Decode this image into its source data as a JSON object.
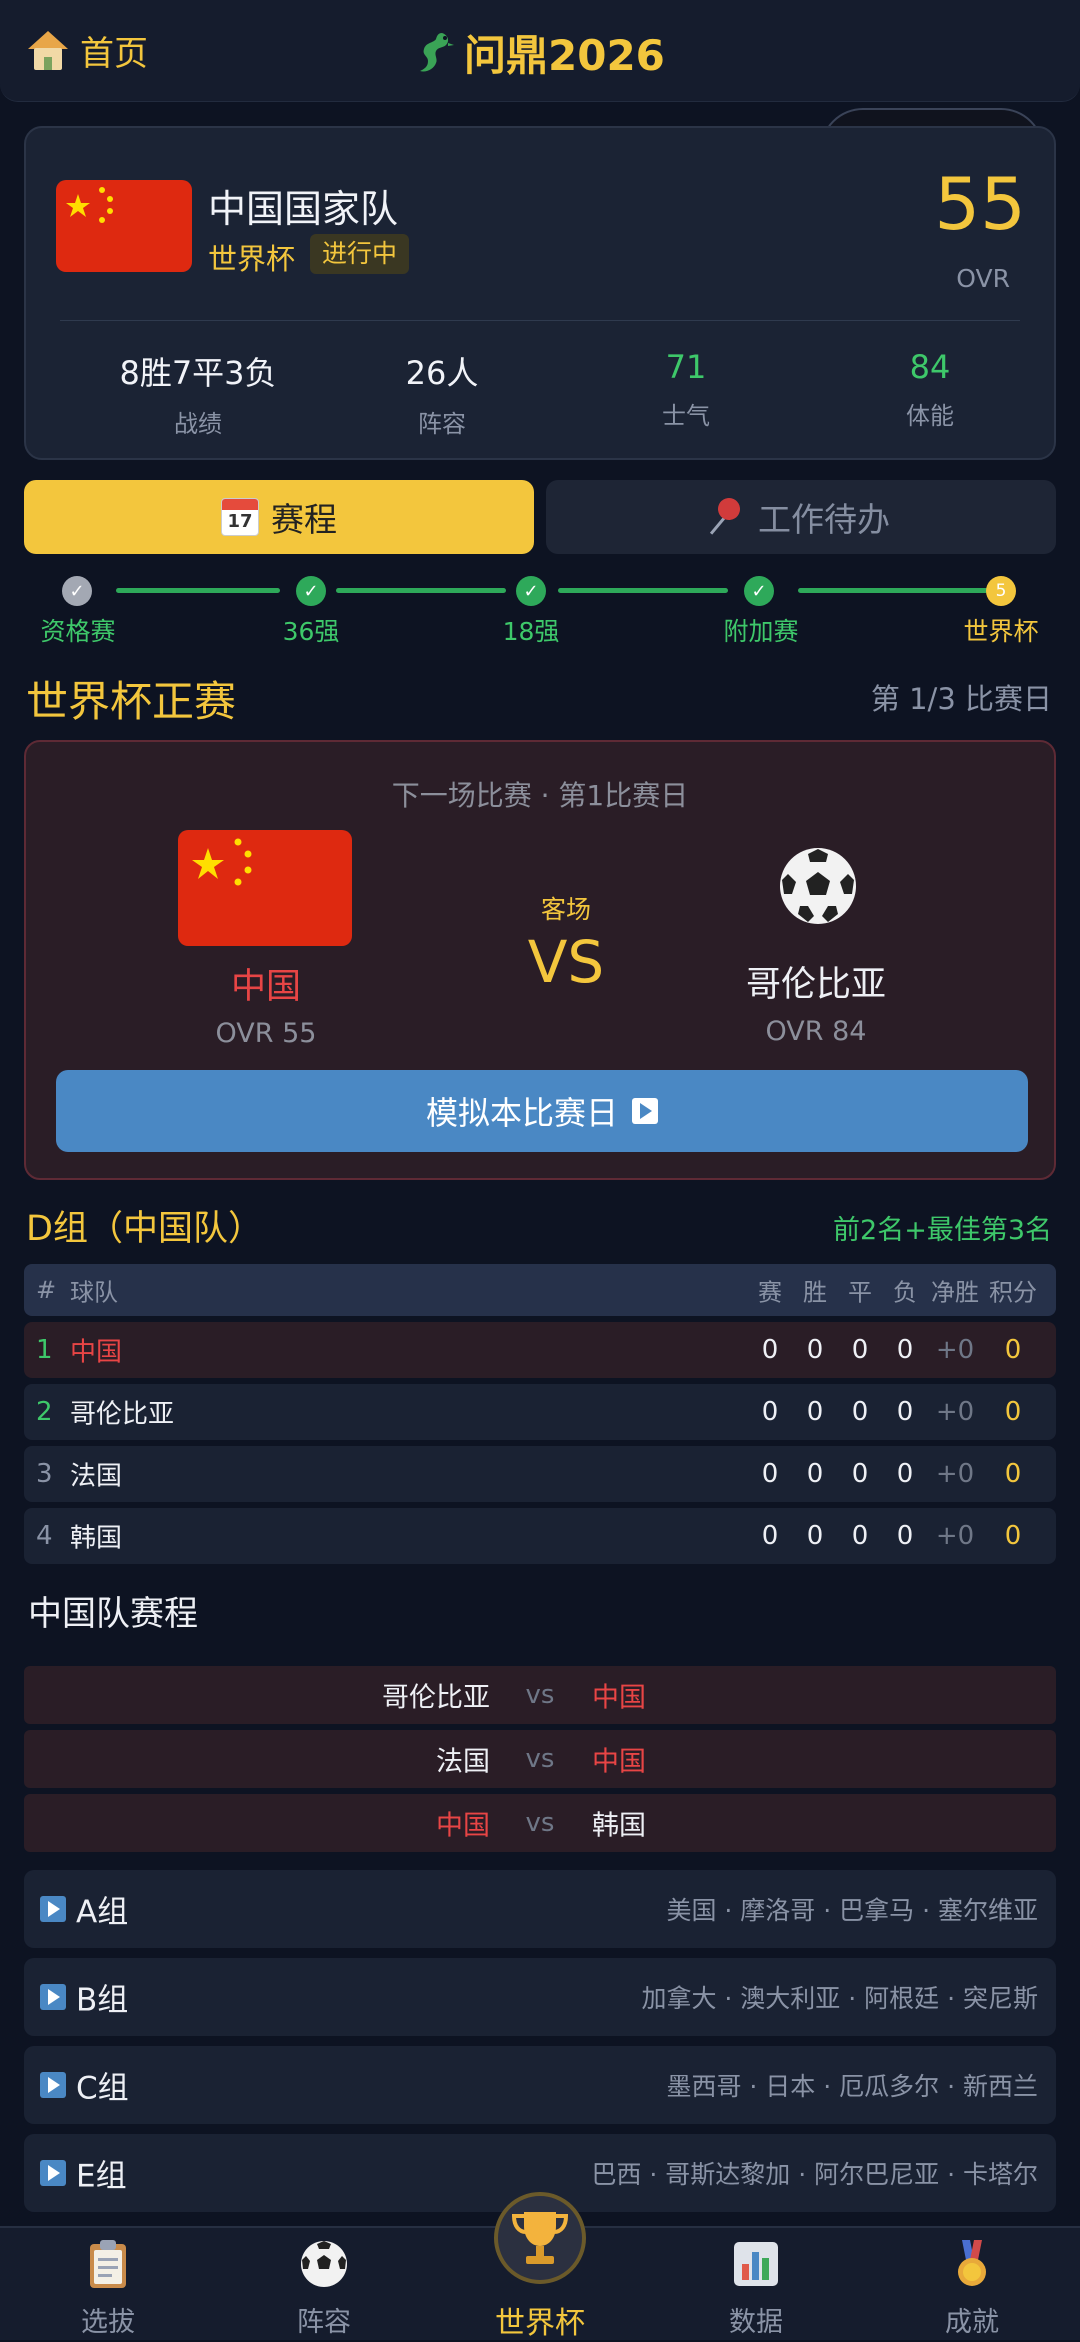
{
  "header": {
    "home_label": "首页",
    "brand": "问鼎2026"
  },
  "team_card": {
    "name": "中国国家队",
    "competition": "世界杯",
    "status": "进行中",
    "ovr": "55",
    "ovr_label": "OVR",
    "stats": [
      {
        "value": "8胜7平3负",
        "label": "战绩"
      },
      {
        "value": "26人",
        "label": "阵容"
      },
      {
        "value": "71",
        "label": "士气"
      },
      {
        "value": "84",
        "label": "体能"
      }
    ]
  },
  "tabs": {
    "schedule": "赛程",
    "todo": "工作待办",
    "calendar_day": "17"
  },
  "progress": {
    "stages": [
      {
        "label": "资格赛",
        "state": "done-grey"
      },
      {
        "label": "36强",
        "state": "done"
      },
      {
        "label": "18强",
        "state": "done"
      },
      {
        "label": "附加赛",
        "state": "done"
      },
      {
        "label": "世界杯",
        "state": "current",
        "num": "5"
      }
    ]
  },
  "section": {
    "title": "世界杯正赛",
    "matchday": "第 1/3 比赛日"
  },
  "next_match": {
    "subtitle": "下一场比赛 · 第1比赛日",
    "home_name": "中国",
    "home_ovr": "OVR 55",
    "venue": "客场",
    "vs": "VS",
    "away_name": "哥伦比亚",
    "away_ovr": "OVR 84",
    "simulate_label": "模拟本比赛日"
  },
  "group": {
    "title": "D组（中国队）",
    "rule": "前2名+最佳第3名",
    "headers": {
      "rank": "#",
      "team": "球队",
      "played": "赛",
      "won": "胜",
      "drawn": "平",
      "lost": "负",
      "gd": "净胜",
      "pts": "积分"
    },
    "rows": [
      {
        "rank": "1",
        "team": "中国",
        "played": "0",
        "won": "0",
        "drawn": "0",
        "lost": "0",
        "gd": "+0",
        "pts": "0"
      },
      {
        "rank": "2",
        "team": "哥伦比亚",
        "played": "0",
        "won": "0",
        "drawn": "0",
        "lost": "0",
        "gd": "+0",
        "pts": "0"
      },
      {
        "rank": "3",
        "team": "法国",
        "played": "0",
        "won": "0",
        "drawn": "0",
        "lost": "0",
        "gd": "+0",
        "pts": "0"
      },
      {
        "rank": "4",
        "team": "韩国",
        "played": "0",
        "won": "0",
        "drawn": "0",
        "lost": "0",
        "gd": "+0",
        "pts": "0"
      }
    ]
  },
  "schedule": {
    "title": "中国队赛程",
    "vs": "vs",
    "fixtures": [
      {
        "home": "哥伦比亚",
        "away": "中国"
      },
      {
        "home": "法国",
        "away": "中国"
      },
      {
        "home": "中国",
        "away": "韩国"
      }
    ]
  },
  "other_groups": [
    {
      "name": "A组",
      "teams": "美国 · 摩洛哥 · 巴拿马 · 塞尔维亚"
    },
    {
      "name": "B组",
      "teams": "加拿大 · 澳大利亚 · 阿根廷 · 突尼斯"
    },
    {
      "name": "C组",
      "teams": "墨西哥 · 日本 · 厄瓜多尔 · 新西兰"
    },
    {
      "name": "E组",
      "teams": "巴西 · 哥斯达黎加 · 阿尔巴尼亚 · 卡塔尔"
    }
  ],
  "bottom_nav": [
    {
      "label": "选拔",
      "icon": "clipboard-icon"
    },
    {
      "label": "阵容",
      "icon": "soccer-ball-icon"
    },
    {
      "label": "世界杯",
      "icon": "trophy-icon",
      "active": true
    },
    {
      "label": "数据",
      "icon": "bar-chart-icon"
    },
    {
      "label": "成就",
      "icon": "medal-icon"
    }
  ],
  "colors": {
    "accent": "#f3c63d",
    "green": "#3ec86a",
    "red": "#e84545",
    "blue_button": "#4a88c4",
    "background": "#0d1322"
  }
}
